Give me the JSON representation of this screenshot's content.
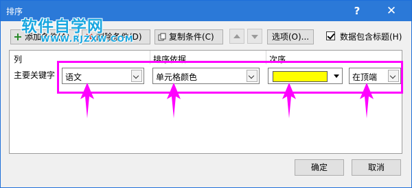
{
  "window": {
    "title": "排序",
    "help_label": "?",
    "close_label": "✕"
  },
  "watermark": {
    "text": "软件自学网",
    "url": "WWW.RJZXW.COM"
  },
  "toolbar": {
    "add_label": "添加条件(A)",
    "delete_label": "删除条件(D)",
    "copy_label": "复制条件(C)",
    "move_up_icon": "triangle-up-icon",
    "move_down_icon": "triangle-down-icon",
    "options_label": "选项(O)...",
    "has_header_label": "数据包含标题(H)",
    "has_header_checked": true
  },
  "grid": {
    "headers": {
      "column": "列",
      "sort_on": "排序依据",
      "order": "次序"
    },
    "rows": [
      {
        "label": "主要关键字",
        "column_value": "语文",
        "sort_on_value": "单元格颜色",
        "color": "#ffff00",
        "position_value": "在顶端"
      }
    ]
  },
  "annotation": {
    "color": "#ff00ff"
  },
  "footer": {
    "ok_label": "确定",
    "cancel_label": "取消"
  }
}
